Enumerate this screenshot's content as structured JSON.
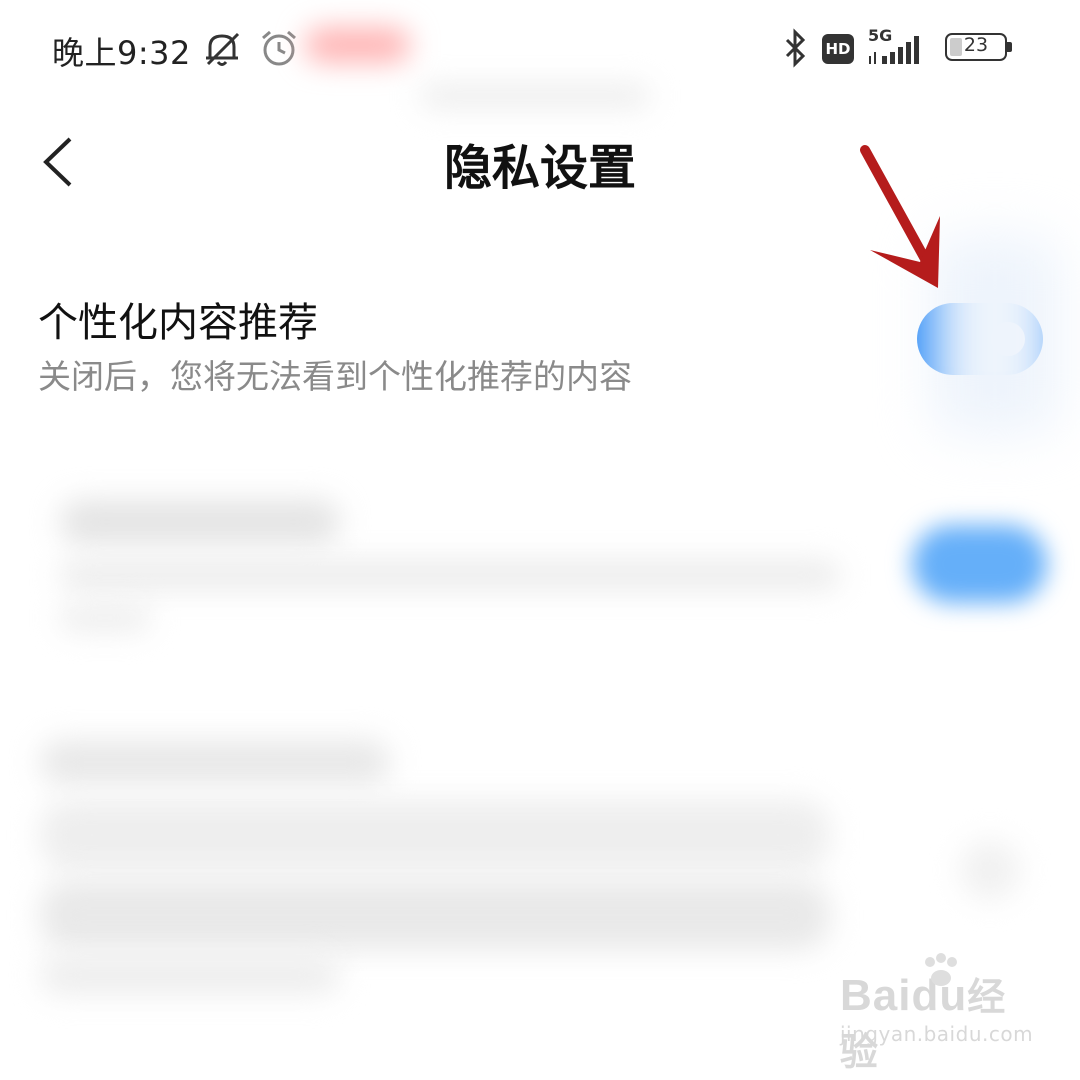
{
  "status_bar": {
    "time": "晚上9:32",
    "icons": [
      "mute-icon",
      "alarm-icon",
      "bluetooth-icon",
      "hd-icon",
      "5g-signal-icon",
      "battery-icon"
    ],
    "hd_label": "HD",
    "network_label": "5G",
    "battery_level": "23"
  },
  "header": {
    "title": "隐私设置",
    "back_icon": "chevron-left-icon"
  },
  "settings": [
    {
      "title": "个性化内容推荐",
      "description": "关闭后，您将无法看到个性化推荐的内容",
      "enabled": true
    }
  ],
  "annotation": {
    "arrow_color": "#b51c1c",
    "arrow_icon": "arrow-down-left-icon"
  },
  "watermark": {
    "brand": "Baidu",
    "brand_cn": "经验",
    "url": "jingyan.baidu.com"
  },
  "colors": {
    "accent": "#1a82f7",
    "secondary_text": "#8a8a8a",
    "annotation": "#b51c1c"
  }
}
